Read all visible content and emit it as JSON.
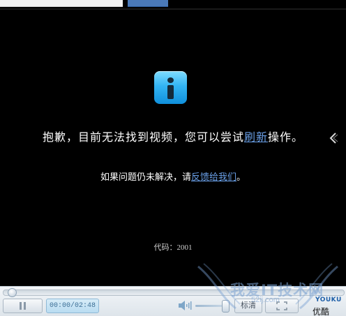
{
  "player": {
    "error_message_prefix": "抱歉，目前无法找到视频，您可以尝试",
    "refresh_link": "刷新",
    "error_message_suffix": "操作。",
    "feedback_prefix": "如果问题仍未解决，请",
    "feedback_link": "反馈给我们",
    "feedback_suffix": "。",
    "error_code_label": "代码：2001"
  },
  "controls": {
    "time": "00:00/02:48",
    "quality": "标清",
    "brand_logo": "YOUKU",
    "brand_cn": "优酷",
    "progress_fraction": 0.0
  },
  "watermark": {
    "text": "我爱IT技术网",
    "url": "52ij.com"
  },
  "colors": {
    "link": "#6aa0e8",
    "info_icon": "#33b4f3",
    "background": "#000000"
  },
  "icons": [
    "info-icon",
    "chevron-left-icon",
    "pause-icon",
    "volume-icon",
    "fullscreen-icon"
  ]
}
